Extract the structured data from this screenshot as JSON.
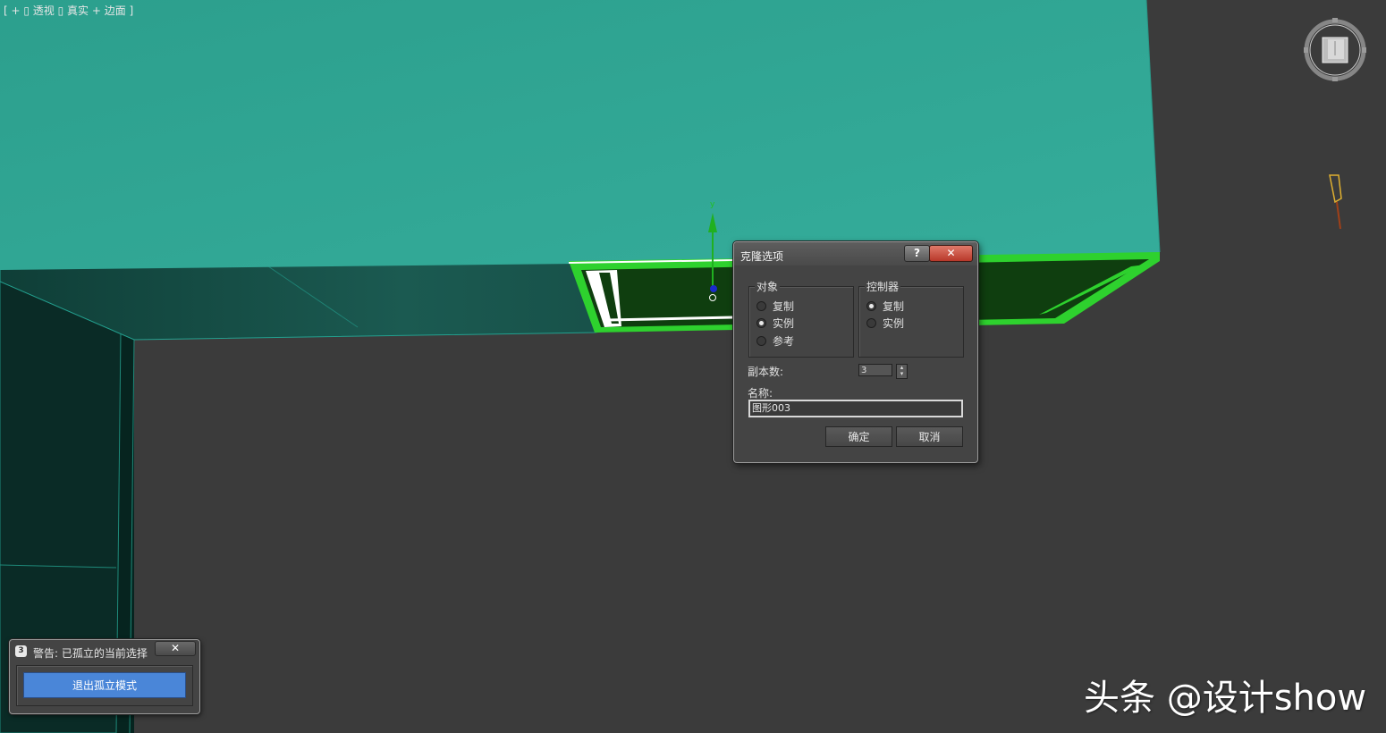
{
  "viewport": {
    "label": "[ + ▯ 透视 ▯ 真实 + 边面 ]",
    "gizmo_axis_label": "y"
  },
  "clone_dialog": {
    "title": "克隆选项",
    "help_button": "?",
    "close_button": "✕",
    "object_group": {
      "title": "对象",
      "options": [
        "复制",
        "实例",
        "参考"
      ],
      "selected": "实例"
    },
    "controller_group": {
      "title": "控制器",
      "options": [
        "复制",
        "实例"
      ],
      "selected": "复制"
    },
    "copies_label": "副本数:",
    "copies_value": "3",
    "name_label": "名称:",
    "name_value": "图形003",
    "ok_button": "确定",
    "cancel_button": "取消"
  },
  "warning_panel": {
    "title": "警告: 已孤立的当前选择",
    "close_button": "✕",
    "exit_isolation_button": "退出孤立模式"
  },
  "watermark": "头条 @设计show",
  "colors": {
    "teal_surface": "#30a896",
    "dark_teal": "#0b3a33",
    "selection_green": "#2ed12e",
    "viewport_bg": "#3b3b3b",
    "primary_button": "#4a86d8"
  }
}
